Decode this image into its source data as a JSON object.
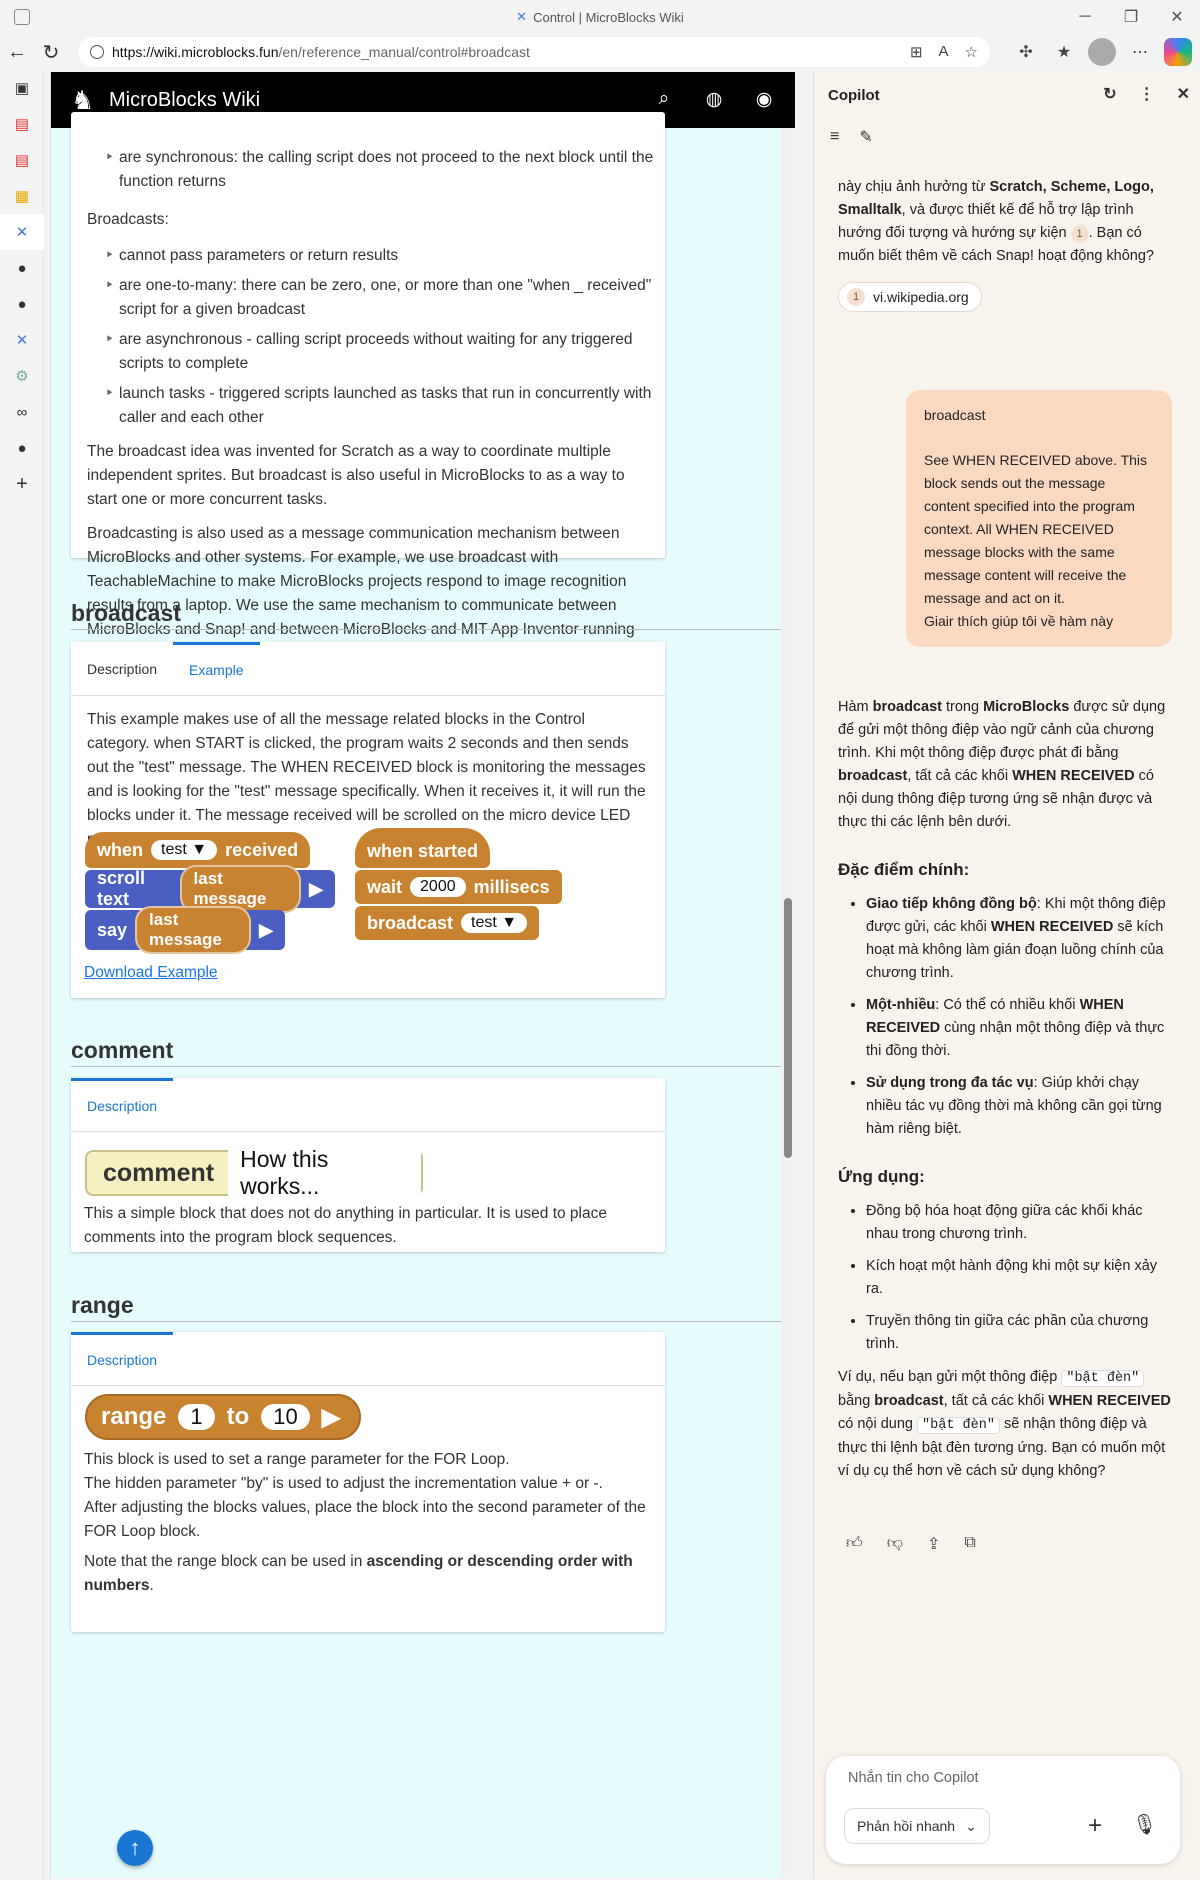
{
  "window": {
    "title": "Control | MicroBlocks Wiki"
  },
  "browser": {
    "url_host": "https://wiki.microblocks.fun",
    "url_path": "/en/reference_manual/control#broadcast"
  },
  "site": {
    "brand": "MicroBlocks Wiki"
  },
  "intro": {
    "bullet_sync": "are synchronous: the calling script does not proceed to the next block until the function returns",
    "broadcasts_label": "Broadcasts:",
    "bullets": [
      "cannot pass parameters or return results",
      "are one-to-many: there can be zero, one, or more than one \"when _ received\" script for a given broadcast",
      "are asynchronous - calling script proceeds without waiting for any triggered scripts to complete",
      "launch tasks - triggered scripts launched as tasks that run in concurrently with caller and each other"
    ],
    "para1": "The broadcast idea was invented for Scratch as a way to coordinate multiple independent sprites. But broadcast is also useful in MicroBlocks to as a way to start one or more concurrent tasks.",
    "para2": "Broadcasting is also used as a message communication mechanism between MicroBlocks and other systems. For example, we use broadcast with TeachableMachine to make MicroBlocks projects respond to image recognition results from a laptop. We use the same mechanism to communicate between MicroBlocks and Snap! and between MicroBlocks and MIT App Inventor running on mobile devices (via Bluetooth BLE in the latter case)."
  },
  "broadcast": {
    "heading": "broadcast",
    "tab_description": "Description",
    "tab_example": "Example",
    "example_text": "This example makes use of all the message related blocks in the Control category. when START is clicked, the program waits 2 seconds and then sends out the \"test\" message. The WHEN RECEIVED block is monitoring the messages and is looking for the \"test\" message specifically. When it receives it, it will run the blocks under it. The message received will be scrolled on the micro device LED panel and displayed in the IDE.",
    "download": "Download Example",
    "blocks": {
      "when": "when",
      "test": "test",
      "received": "received",
      "scroll_text": "scroll text",
      "last_message": "last message",
      "say": "say",
      "when_started": "when started",
      "wait": "wait",
      "wait_value": "2000",
      "millisecs": "millisecs",
      "broadcast": "broadcast"
    }
  },
  "comment": {
    "heading": "comment",
    "tab_description": "Description",
    "block_label": "comment",
    "block_value": "How this works...",
    "text": "This a simple block that does not do anything in particular. It is used to place comments into the program block sequences."
  },
  "range": {
    "heading": "range",
    "tab_description": "Description",
    "block_label": "range",
    "from": "1",
    "to_label": "to",
    "to": "10",
    "line1": "This block is used to set a range parameter for the FOR Loop.",
    "line2": "The hidden parameter \"by\" is used to adjust the incrementation value + or -.",
    "line3": "After adjusting the blocks values, place the block into the second parameter of the FOR Loop block.",
    "note_pre": "Note that the range block can be used in ",
    "note_bold": "ascending or descending order with numbers",
    "note_post": "."
  },
  "copilot": {
    "title": "Copilot",
    "intro_html_parts": {
      "p1": "này chịu ảnh hưởng từ ",
      "b1": "Scratch, Scheme, Logo, Smalltalk",
      "p2": ", và được thiết kế để hỗ trợ lập trình hướng đối tượng và hướng sự kiện ",
      "cite": "1",
      "p3": ". Bạn có muốn biết thêm về cách Snap! hoạt động không?"
    },
    "source_num": "1",
    "source_label": "vi.wikipedia.org",
    "user_message": {
      "title": "broadcast",
      "body": "See WHEN RECEIVED above. This block sends out the message content specified into the program context. All WHEN RECEIVED message blocks with the same message content will receive the message and act on it.",
      "question": "Giair thích giúp tôi về hàm này"
    },
    "answer": {
      "p1a": "Hàm ",
      "p1b": "broadcast",
      "p1c": " trong ",
      "p1d": "MicroBlocks",
      "p1e": " được sử dụng để gửi một thông điệp vào ngữ cảnh của chương trình. Khi một thông điệp được phát đi bằng ",
      "p1f": "broadcast",
      "p1g": ", tất cả các khối ",
      "p1h": "WHEN RECEIVED",
      "p1i": " có nội dung thông điệp tương ứng sẽ nhận được và thực thi các lệnh bên dưới.",
      "h_features": "Đặc điểm chính:",
      "f1b": "Giao tiếp không đồng bộ",
      "f1a": ": Khi một thông điệp được gửi, các khối ",
      "f1c": "WHEN RECEIVED",
      "f1d": " sẽ kích hoạt mà không làm gián đoạn luồng chính của chương trình.",
      "f2b": "Một-nhiều",
      "f2a": ": Có thể có nhiều khối ",
      "f2c": "WHEN RECEIVED",
      "f2d": " cùng nhận một thông điệp và thực thi đồng thời.",
      "f3b": "Sử dụng trong đa tác vụ",
      "f3a": ": Giúp khởi chạy nhiều tác vụ đồng thời mà không cần gọi từng hàm riêng biệt.",
      "h_apps": "Ứng dụng:",
      "a1": "Đồng bộ hóa hoạt động giữa các khối khác nhau trong chương trình.",
      "a2": "Kích hoạt một hành động khi một sự kiện xảy ra.",
      "a3": "Truyền thông tin giữa các phần của chương trình.",
      "e1": "Ví dụ, nếu bạn gửi một thông điệp ",
      "ecode": "\"bật đèn\"",
      "e2": " bằng ",
      "eb1": "broadcast",
      "e3": ", tất cả các khối ",
      "eb2": "WHEN RECEIVED",
      "e4": " có nội dung ",
      "e5": " sẽ nhận thông điệp và thực thi lệnh bật đèn tương ứng. Bạn có muốn một ví dụ cụ thể hơn về cách sử dụng không?"
    },
    "composer_placeholder": "Nhắn tin cho Copilot",
    "mode": "Phản hồi nhanh"
  },
  "colors": {
    "control_orange": "#c88330",
    "output_blue": "#4a5fc1",
    "page_bg": "#e6fbfc"
  }
}
